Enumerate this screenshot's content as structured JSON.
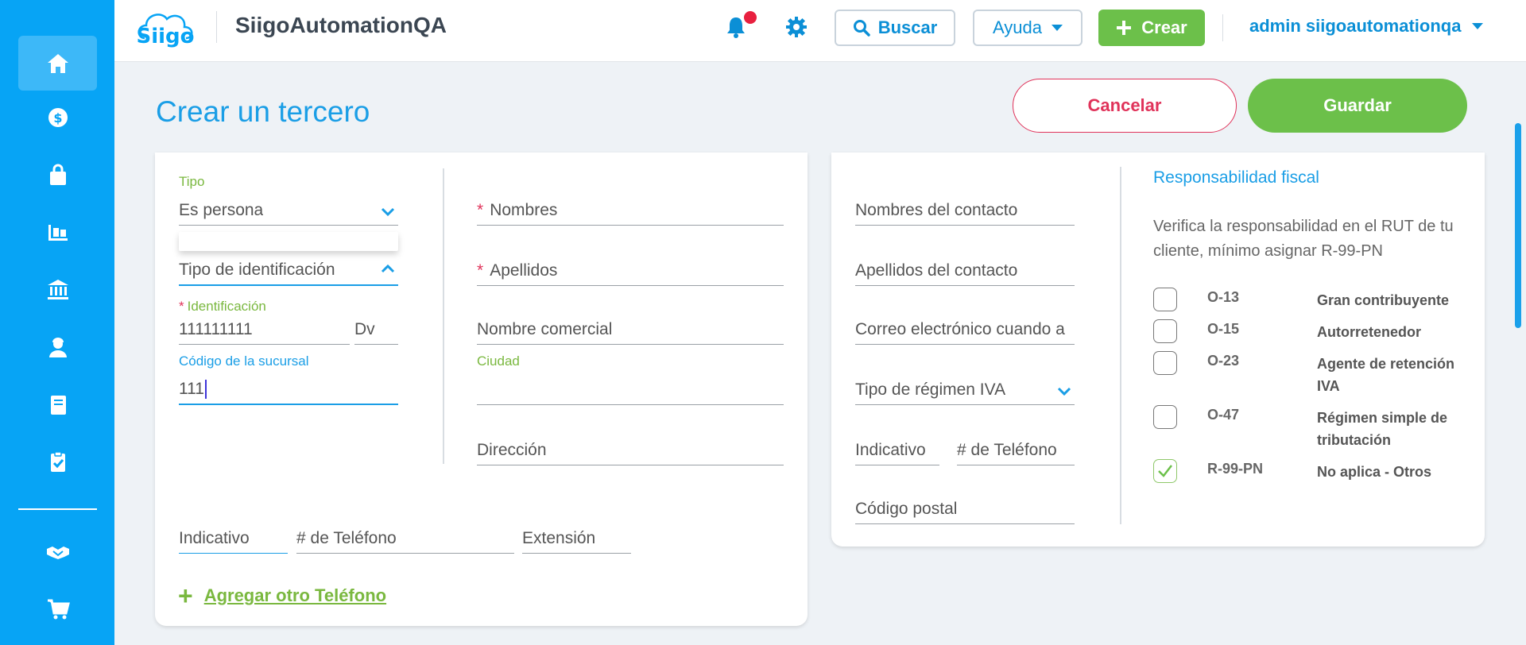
{
  "header": {
    "logo": "Siigo",
    "company": "SiigoAutomationQA",
    "search_label": "Buscar",
    "help_label": "Ayuda",
    "create_label": "Crear",
    "user": "admin siigoautomationqa"
  },
  "page": {
    "title": "Crear un tercero",
    "cancel_label": "Cancelar",
    "save_label": "Guardar"
  },
  "left_form": {
    "tipo_label": "Tipo",
    "tipo_value": "Es persona",
    "tipo_identificacion": "Tipo de identificación",
    "identificacion_label": "Identificación",
    "identificacion_value": "111111111",
    "dv": "Dv",
    "codigo_sucursal_label": "Código de la sucursal",
    "codigo_sucursal_value": "111",
    "nombres": "Nombres",
    "apellidos": "Apellidos",
    "nombre_comercial": "Nombre comercial",
    "ciudad_label": "Ciudad",
    "direccion": "Dirección",
    "indicativo": "Indicativo",
    "telefono": "# de Teléfono",
    "extension": "Extensión",
    "add_phone": "Agregar otro Teléfono"
  },
  "right_form": {
    "nombres_contacto": "Nombres del contacto",
    "apellidos_contacto": "Apellidos del contacto",
    "correo": "Correo electrónico cuando a",
    "tipo_regimen": "Tipo de régimen IVA",
    "indicativo": "Indicativo",
    "telefono": "# de Teléfono",
    "codigo_postal": "Código postal"
  },
  "responsabilidad": {
    "title": "Responsabilidad fiscal",
    "description": "Verifica la responsabilidad en el RUT de tu cliente, mínimo asignar R-99-PN",
    "items": [
      {
        "code": "O-13",
        "name": "Gran contribuyente",
        "checked": false
      },
      {
        "code": "O-15",
        "name": "Autorretenedor",
        "checked": false
      },
      {
        "code": "O-23",
        "name": "Agente de retención IVA",
        "checked": false
      },
      {
        "code": "O-47",
        "name": "Régimen simple de tributación",
        "checked": false
      },
      {
        "code": "R-99-PN",
        "name": "No aplica - Otros",
        "checked": true
      }
    ]
  },
  "colors": {
    "sidebar": "#07a4f5",
    "accent_blue": "#1a9ee6",
    "green": "#6cc04a",
    "danger": "#e0335a"
  }
}
